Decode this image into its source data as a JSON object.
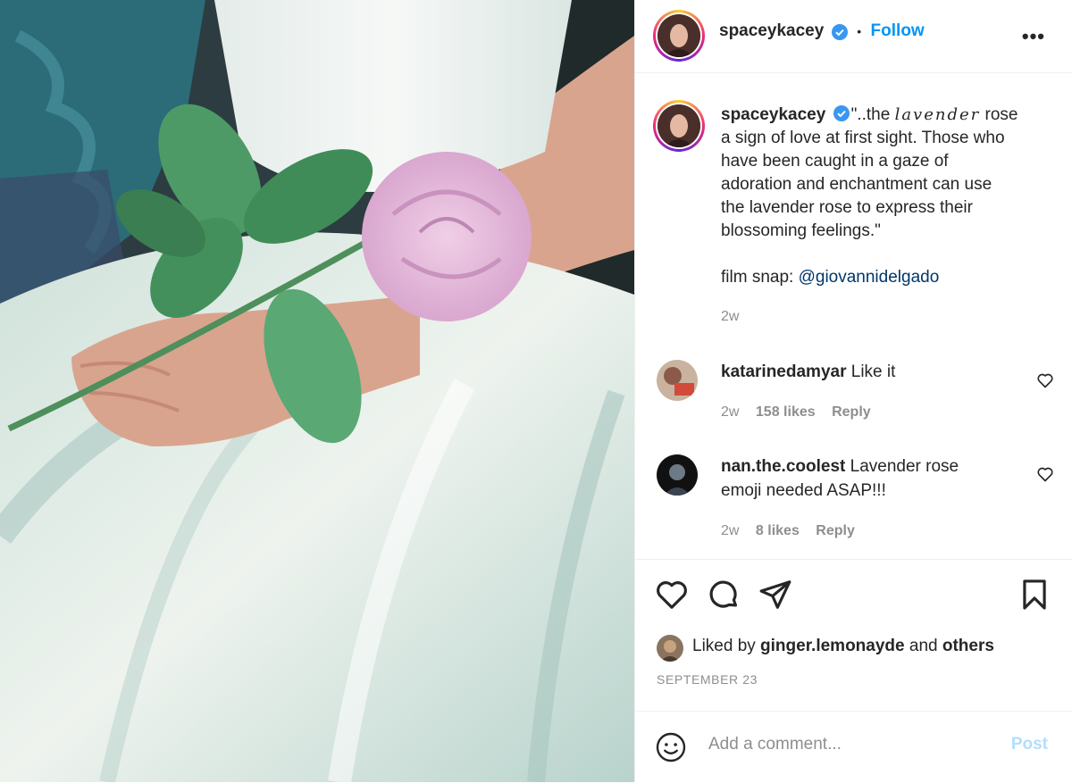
{
  "post": {
    "username": "spaceykacey",
    "follow_label": "Follow",
    "separator": "•",
    "more_label": "•••"
  },
  "caption": {
    "username": "spaceykacey",
    "line1_pre": "\"..the ",
    "line1_fancy": "lavender",
    "line1_post": " rose",
    "line2": "a sign of love at first sight. Those who",
    "line3": "have been caught in a gaze of",
    "line4": "adoration and enchantment can use",
    "line5": "the lavender rose to express their",
    "line6": "blossoming feelings.\"",
    "credit_label": "film snap: ",
    "credit_mention": "@giovannidelgado",
    "time": "2w"
  },
  "comments": [
    {
      "username": "katarinedamyar",
      "text": "Like it",
      "time": "2w",
      "likes": "158 likes",
      "reply": "Reply"
    },
    {
      "username": "nan.the.coolest",
      "text_line1": "Lavender rose",
      "text_line2": "emoji needed ASAP!!!",
      "time": "2w",
      "likes": "8 likes",
      "reply": "Reply"
    }
  ],
  "likes": {
    "prefix": "Liked by ",
    "user": "ginger.lemonayde",
    "and": " and ",
    "others": "others"
  },
  "date": "SEPTEMBER 23",
  "composer": {
    "placeholder": "Add a comment...",
    "post_label": "Post"
  },
  "colors": {
    "accent": "#0095f6",
    "post_disabled": "#b2dffc",
    "mention": "#00376b",
    "muted": "#8e8e8e"
  },
  "icons": [
    "verified-badge-icon",
    "heart-icon",
    "comment-icon",
    "share-icon",
    "bookmark-icon",
    "emoji-icon",
    "more-icon"
  ]
}
